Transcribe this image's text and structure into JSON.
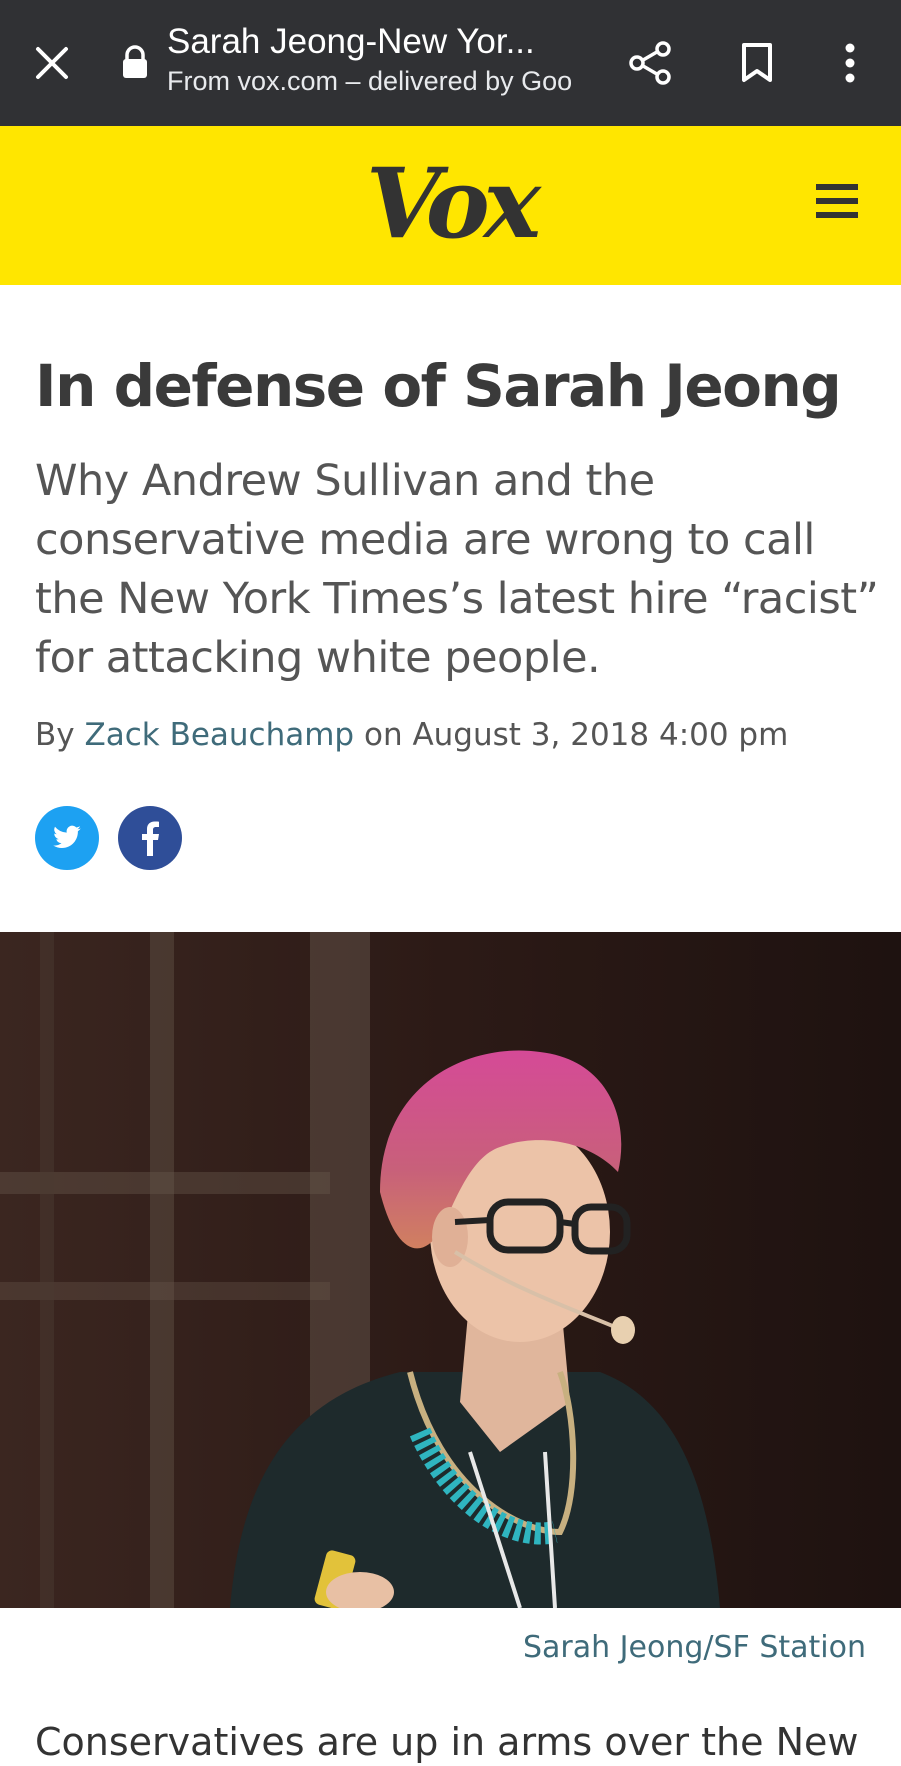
{
  "browser": {
    "title": "Sarah Jeong-New Yor...",
    "subtitle": "From vox.com – delivered by Goo",
    "icons": [
      "close-icon",
      "lock-icon",
      "share-icon",
      "bookmark-icon",
      "more-vert-icon"
    ]
  },
  "site": {
    "logo_text": "Vox",
    "brand_color": "#FFE600"
  },
  "article": {
    "headline": "In defense of Sarah Jeong",
    "dek": "Why Andrew Sullivan and the conservative media are wrong to call the New York Times’s latest hire “racist” for attacking white people.",
    "byline_prefix": "By",
    "author": "Zack Beauchamp",
    "date_text": "on August 3, 2018 4:00 pm",
    "social": [
      {
        "name": "twitter",
        "color": "#1DA1F2"
      },
      {
        "name": "facebook",
        "color": "#2F4E98"
      }
    ],
    "image_caption": "Sarah Jeong/SF Station",
    "body_first_line": "Conservatives are up in arms over the New"
  }
}
